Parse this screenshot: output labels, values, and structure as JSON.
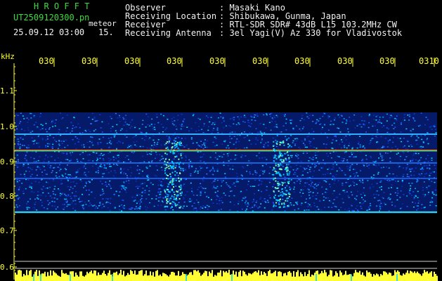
{
  "header": {
    "app_name": "H R O F F T",
    "filename": "UT2509120300.pn",
    "meteor_label": "meteor",
    "timestamp": "25.09.12 03:00",
    "count": "15.",
    "observer_label": "Observer",
    "observer_value": ": Masaki Kano",
    "location_label": "Receiving Location",
    "location_value": ": Shibukawa, Gunma, Japan",
    "receiver_label": "Receiver",
    "receiver_value": ": RTL-SDR SDR# 43dB L15 103.2MHz CW",
    "antenna_label": "Receiving Antenna",
    "antenna_value": ": 3el Yagi(V) Az 330 for Vladivostok"
  },
  "axis": {
    "unit_label": "kHz",
    "y_ticks": [
      "1.1",
      "1.0",
      "0.9",
      "0.8",
      "0.7",
      "0.6"
    ],
    "x_ticks": [
      "030",
      "030",
      "030",
      "030",
      "030",
      "030",
      "030",
      "030",
      "030",
      "0310"
    ]
  },
  "colors": {
    "background": "#000000",
    "axis": "#ffff33",
    "title": "#3ddc3d",
    "text": "#f2f2f2",
    "noise": "#0a2fb8",
    "signal": "#00e0ff",
    "carrier": "#ff6a00"
  }
}
